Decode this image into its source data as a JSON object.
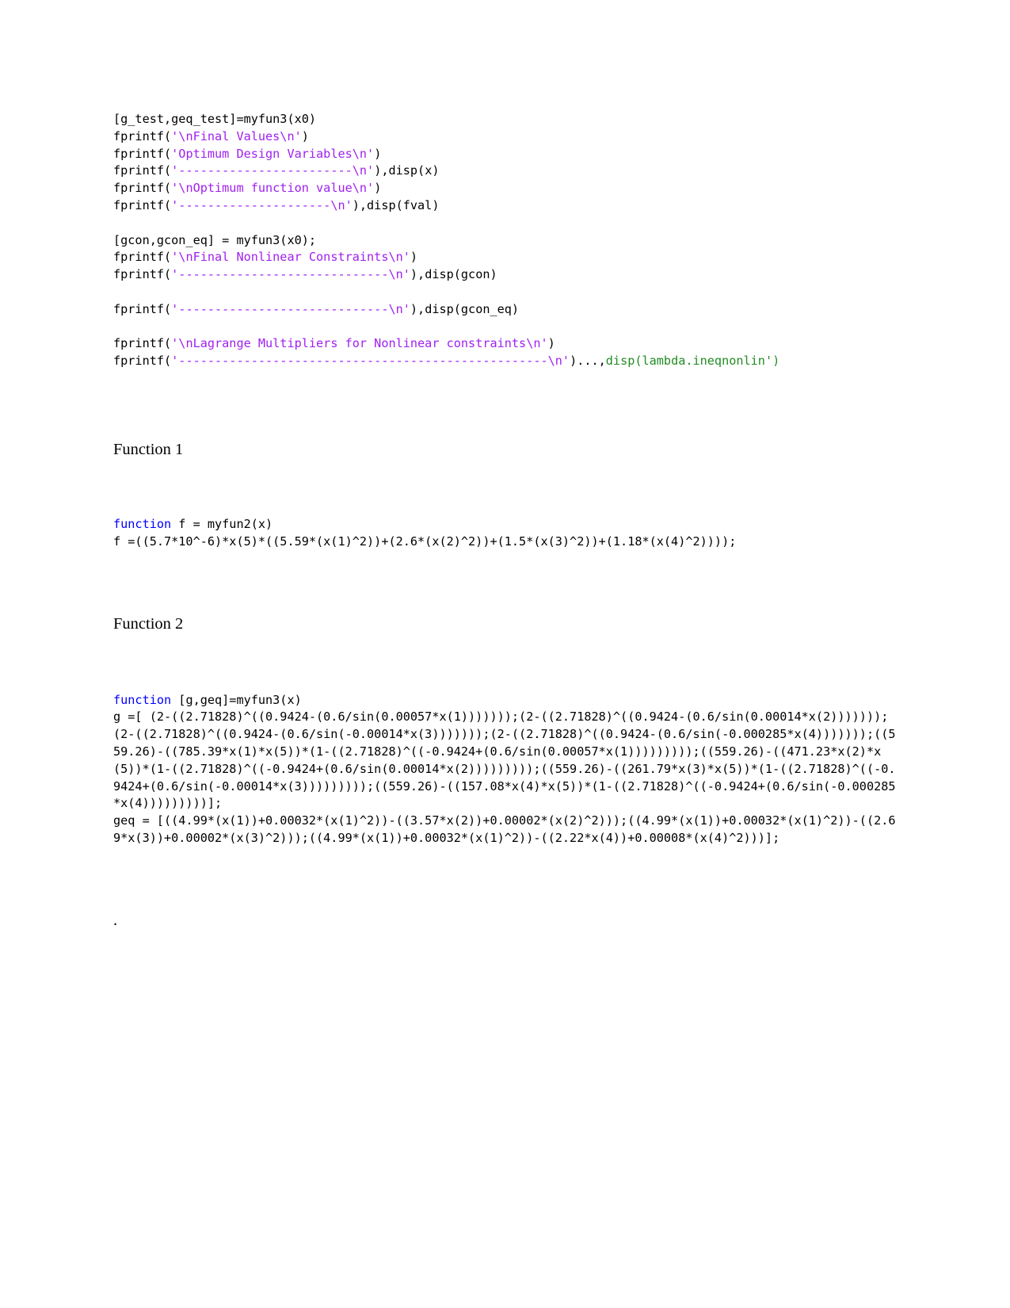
{
  "document": {
    "title": "MATLAB Optimization Script Listing",
    "colors": {
      "string": "#a020f0",
      "keyword": "#0000ff",
      "function": "#228b22",
      "text": "#000000",
      "background": "#ffffff"
    }
  },
  "blocks": {
    "script_block": {
      "lines": [
        {
          "segments": [
            {
              "style": "plain",
              "text": "[g_test,geq_test]=myfun3(x0)"
            }
          ]
        },
        {
          "segments": [
            {
              "style": "plain",
              "text": "fprintf("
            },
            {
              "style": "string",
              "text": "'\\nFinal Values\\n'"
            },
            {
              "style": "plain",
              "text": ")"
            }
          ]
        },
        {
          "segments": [
            {
              "style": "plain",
              "text": "fprintf("
            },
            {
              "style": "string",
              "text": "'Optimum Design Variables\\n'"
            },
            {
              "style": "plain",
              "text": ")"
            }
          ]
        },
        {
          "segments": [
            {
              "style": "plain",
              "text": "fprintf("
            },
            {
              "style": "string",
              "text": "'------------------------\\n'"
            },
            {
              "style": "plain",
              "text": "),disp(x)"
            }
          ]
        },
        {
          "segments": [
            {
              "style": "plain",
              "text": "fprintf("
            },
            {
              "style": "string",
              "text": "'\\nOptimum function value\\n'"
            },
            {
              "style": "plain",
              "text": ")"
            }
          ]
        },
        {
          "segments": [
            {
              "style": "plain",
              "text": "fprintf("
            },
            {
              "style": "string",
              "text": "'---------------------\\n'"
            },
            {
              "style": "plain",
              "text": "),disp(fval)"
            }
          ]
        },
        {
          "segments": [
            {
              "style": "plain",
              "text": ""
            }
          ]
        },
        {
          "segments": [
            {
              "style": "plain",
              "text": "[gcon,gcon_eq] = myfun3(x0);"
            }
          ]
        },
        {
          "segments": [
            {
              "style": "plain",
              "text": "fprintf("
            },
            {
              "style": "string",
              "text": "'\\nFinal Nonlinear Constraints\\n'"
            },
            {
              "style": "plain",
              "text": ")"
            }
          ]
        },
        {
          "segments": [
            {
              "style": "plain",
              "text": "fprintf("
            },
            {
              "style": "string",
              "text": "'-----------------------------\\n'"
            },
            {
              "style": "plain",
              "text": "),disp(gcon)"
            }
          ]
        },
        {
          "segments": [
            {
              "style": "plain",
              "text": ""
            }
          ]
        },
        {
          "segments": [
            {
              "style": "plain",
              "text": "fprintf("
            },
            {
              "style": "string",
              "text": "'-----------------------------\\n'"
            },
            {
              "style": "plain",
              "text": "),disp(gcon_eq)"
            }
          ]
        },
        {
          "segments": [
            {
              "style": "plain",
              "text": ""
            }
          ]
        },
        {
          "segments": [
            {
              "style": "plain",
              "text": "fprintf("
            },
            {
              "style": "string",
              "text": "'\\nLagrange Multipliers for Nonlinear constraints\\n'"
            },
            {
              "style": "plain",
              "text": ")"
            }
          ]
        },
        {
          "segments": [
            {
              "style": "plain",
              "text": "fprintf("
            },
            {
              "style": "string",
              "text": "'---------------------------------------------------\\n'"
            },
            {
              "style": "plain",
              "text": ")...,"
            },
            {
              "style": "function",
              "text": "disp(lambda.ineqnonlin')"
            }
          ]
        }
      ]
    },
    "function1": {
      "heading": "Function 1",
      "lines": [
        {
          "segments": [
            {
              "style": "keyword",
              "text": "function"
            },
            {
              "style": "plain",
              "text": " f = myfun2(x)"
            }
          ]
        },
        {
          "segments": [
            {
              "style": "plain",
              "text": "f =((5.7*10^-6)*x(5)*((5.59*(x(1)^2))+(2.6*(x(2)^2))+(1.5*(x(3)^2))+(1.18*(x(4)^2))));"
            }
          ]
        }
      ]
    },
    "function2": {
      "heading": "Function 2",
      "lines": [
        {
          "segments": [
            {
              "style": "keyword",
              "text": "function"
            },
            {
              "style": "plain",
              "text": " [g,geq]=myfun3(x)"
            }
          ]
        },
        {
          "segments": [
            {
              "style": "plain",
              "text": "g =[ (2-((2.71828)^((0.9424-(0.6/sin(0.00057*x(1)))))));(2-((2.71828)^((0.9424-(0.6/sin(0.00014*x(2)))))));(2-((2.71828)^((0.9424-(0.6/sin(-0.00014*x(3)))))));(2-((2.71828)^((0.9424-(0.6/sin(-0.000285*x(4)))))));((559.26)-((785.39*x(1)*x(5))*(1-((2.71828)^((-0.9424+(0.6/sin(0.00057*x(1)))))))));((559.26)-((471.23*x(2)*x(5))*(1-((2.71828)^((-0.9424+(0.6/sin(0.00014*x(2)))))))));((559.26)-((261.79*x(3)*x(5))*(1-((2.71828)^((-0.9424+(0.6/sin(-0.00014*x(3)))))))));((559.26)-((157.08*x(4)*x(5))*(1-((2.71828)^((-0.9424+(0.6/sin(-0.000285*x(4)))))))))];"
            }
          ]
        },
        {
          "segments": [
            {
              "style": "plain",
              "text": "geq = [((4.99*(x(1))+0.00032*(x(1)^2))-((3.57*x(2))+0.00002*(x(2)^2)));((4.99*(x(1))+0.00032*(x(1)^2))-((2.69*x(3))+0.00002*(x(3)^2)));((4.99*(x(1))+0.00032*(x(1)^2))-((2.22*x(4))+0.00008*(x(4)^2)))];"
            }
          ]
        }
      ]
    },
    "footer": {
      "text": "."
    }
  }
}
